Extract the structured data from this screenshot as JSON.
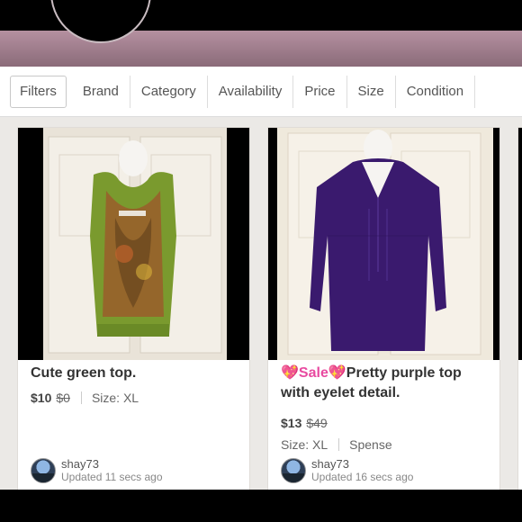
{
  "filters": [
    "Filters",
    "Brand",
    "Category",
    "Availability",
    "Price",
    "Size",
    "Condition"
  ],
  "listings": [
    {
      "title": "Cute green top.",
      "price": "$10",
      "original_price": "$0",
      "size": "Size: XL",
      "seller": "shay73",
      "updated": "Updated 11 secs ago",
      "image": "green-paisley-top-photo"
    },
    {
      "title_prefix": "💖Sale💖",
      "title": "Pretty purple top with eyelet detail.",
      "price": "$13",
      "original_price": "$49",
      "size": "Size: XL",
      "brand": "Spense",
      "seller": "shay73",
      "updated": "Updated 16 secs ago",
      "image": "purple-blouse-photo"
    }
  ],
  "colors": {
    "banner": "#8a6b79",
    "card_bg": "#ffffff",
    "grid_bg": "#ebe9e6",
    "sale_heart": "#e84aa0"
  }
}
